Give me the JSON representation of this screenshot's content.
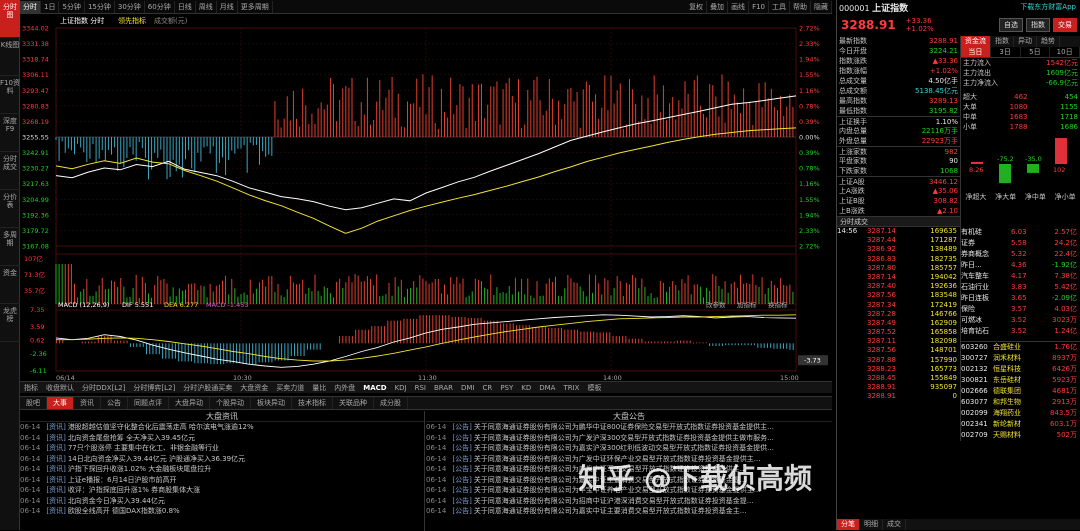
{
  "nav": [
    "分时图",
    "K线图",
    "F10资料",
    "深度F9",
    "分时成交",
    "分价表",
    "多周期",
    "资金",
    "龙虎榜"
  ],
  "toolbar": {
    "tabs": [
      "分时",
      "1日",
      "5分钟",
      "15分钟",
      "30分钟",
      "60分钟",
      "日线",
      "周线",
      "月线",
      "更多周期"
    ],
    "right": [
      "复权",
      "叠加",
      "画线",
      "F10",
      "工具",
      "帮助",
      "隐藏"
    ]
  },
  "chart_header": {
    "name": "上证指数",
    "period": "分时",
    "indicator": "领先指标",
    "volume_label": "成交额(元)"
  },
  "price_axis": {
    "left": [
      "3344.02",
      "3331.38",
      "3318.74",
      "3306.11",
      "3293.47",
      "3280.83",
      "3268.19",
      "3255.55",
      "3242.91",
      "3230.27",
      "3217.63",
      "3204.99",
      "3192.36",
      "3179.72",
      "3167.08"
    ],
    "right": [
      "2.72%",
      "2.33%",
      "1.94%",
      "1.55%",
      "1.16%",
      "0.78%",
      "0.39%",
      "0.00%",
      "0.39%",
      "0.78%",
      "1.16%",
      "1.55%",
      "1.94%",
      "2.33%",
      "2.72%"
    ]
  },
  "volume_axis": [
    "107亿",
    "71.3亿",
    "35.7亿"
  ],
  "macd": {
    "label": "MACD (12,26,9)",
    "dif": "DIF 5.551",
    "dea": "DEA 6.277",
    "macd": "MACD -1.453",
    "axis": [
      "7.35",
      "3.59",
      "0.62",
      "-2.36",
      "-6.11"
    ],
    "current": "-3.73",
    "right_tools": [
      "改参数",
      "加指标",
      "换指标"
    ]
  },
  "time_axis": [
    "06/14",
    "10:30",
    "11:30",
    "14:00",
    "15:00"
  ],
  "indicator_tabs": [
    "指标",
    "收盘默认",
    "分时DDX[L2]",
    "分时博弈[L2]",
    "分时沪股通买卖",
    "大盘资金",
    "买卖力道",
    "量比",
    "内外盘",
    "MACD",
    "KDJ",
    "RSI",
    "BRAR",
    "DMI",
    "CR",
    "PSY",
    "KD",
    "DMA",
    "TRIX",
    "模板"
  ],
  "news": {
    "tabs": [
      "股吧",
      "大事",
      "资讯",
      "公告",
      "同题点评",
      "大盘异动",
      "个股异动",
      "板块异动",
      "技术指标",
      "关联品种",
      "成分股"
    ],
    "left_title": "大盘资讯",
    "right_title": "大盘公告",
    "left": [
      {
        "d": "06-14",
        "t": "[资讯]",
        "s": "港股超越估值坚守化整合化后震荡走高 哈尔滨电气涨逾12%"
      },
      {
        "d": "06-14",
        "t": "[资讯]",
        "s": "北向资金尾盘抢筹 全天净买入39.45亿元"
      },
      {
        "d": "06-14",
        "t": "[资讯]",
        "s": "77只个股涨停 主要集中在化工、非银金融等行业"
      },
      {
        "d": "06-14",
        "t": "[资讯]",
        "s": "14日北向资金净买入39.44亿元 沪股通净买入36.39亿元"
      },
      {
        "d": "06-14",
        "t": "[资讯]",
        "s": "沪指下探回升收涨1.02% 大金融板块尾盘拉升"
      },
      {
        "d": "06-14",
        "t": "[资讯]",
        "s": "上证e播报：6月14日沪股市前高开"
      },
      {
        "d": "06-14",
        "t": "[资讯]",
        "s": "收评：沪指探底回升涨1% 券商股集体大涨"
      },
      {
        "d": "06-14",
        "t": "[资讯]",
        "s": "北向资金今日净买入39.44亿元"
      },
      {
        "d": "06-14",
        "t": "[资讯]",
        "s": "欧股全线高开 德国DAX指数涨0.8%"
      }
    ],
    "right": [
      {
        "d": "06-14",
        "t": "[公告]",
        "s": "关于同意海通证券股份有限公司为鹏华中证800证券保险交易型开放式指数证券投资基金提供主..."
      },
      {
        "d": "06-14",
        "t": "[公告]",
        "s": "关于同意海通证券股份有限公司为广发沪深300交易型开放式指数证券投资基金提供主做市服务..."
      },
      {
        "d": "06-14",
        "t": "[公告]",
        "s": "关于同意海通证券股份有限公司为嘉实沪深300红利低波动交易型开放式指数证券投资基金提供..."
      },
      {
        "d": "06-14",
        "t": "[公告]",
        "s": "关于同意海通证券股份有限公司为广发中证环保产业交易型开放式指数证券投资基金提供主..."
      },
      {
        "d": "06-14",
        "t": "[公告]",
        "s": "关于同意海通证券股份有限公司为广发中证军工交易型开放式指数证券投资基金提供主..."
      },
      {
        "d": "06-14",
        "t": "[公告]",
        "s": "关于同意海通证券股份有限公司为嘉实中证主要消费交易型开放式指数证券投资基金提..."
      },
      {
        "d": "06-14",
        "t": "[公告]",
        "s": "关于同意海通证券股份有限公司为华宝中证养老产业交易型开放式指数证券投资基金提供主..."
      },
      {
        "d": "06-14",
        "t": "[公告]",
        "s": "关于同意海通证券股份有限公司为招商中证沪港深消费交易型开放式指数证券投资基金提..."
      },
      {
        "d": "06-14",
        "t": "[公告]",
        "s": "关于同意海通证券股份有限公司为嘉实中证主要消费交易型开放式指数证券投资基金主..."
      }
    ]
  },
  "quote": {
    "code": "000001",
    "name": "上证指数",
    "price": "3288.91",
    "change": "+33.36",
    "pct": "+1.02%",
    "download": "下载东方财富App",
    "buttons": {
      "watch": "自选",
      "index": "指数",
      "trade": "交易"
    },
    "fields": [
      {
        "k": "最新指数",
        "v": "3288.91",
        "c": "red"
      },
      {
        "k": "今日开盘",
        "v": "3224.21",
        "c": "grn"
      },
      {
        "k": "指数涨跌",
        "v": "▲33.36",
        "c": "red"
      },
      {
        "k": "指数涨幅",
        "v": "+1.02%",
        "c": "red"
      },
      {
        "k": "总成交量",
        "v": "4.50亿手",
        "c": "wht"
      },
      {
        "k": "总成交额",
        "v": "5138.45亿元",
        "c": "cyan"
      },
      {
        "k": "最高指数",
        "v": "3289.13",
        "c": "red"
      },
      {
        "k": "最低指数",
        "v": "3195.82",
        "c": "grn"
      },
      {
        "k": "上证换手",
        "v": "1.10%",
        "c": "wht"
      },
      {
        "k": "内盘总量",
        "v": "22116万手",
        "c": "grn"
      },
      {
        "k": "外盘总量",
        "v": "22923万手",
        "c": "red"
      },
      {
        "k": "上涨家数",
        "v": "982",
        "c": "red"
      },
      {
        "k": "平盘家数",
        "v": "90",
        "c": "wht"
      },
      {
        "k": "下跌家数",
        "v": "1068",
        "c": "grn"
      },
      {
        "k": "上证A股",
        "v": "3446.12",
        "c": "red"
      },
      {
        "k": "上A涨跌",
        "v": "▲35.06",
        "c": "red"
      },
      {
        "k": "上证B股",
        "v": "308.82",
        "c": "red"
      },
      {
        "k": "上B涨跌",
        "v": "▲2.10",
        "c": "red"
      }
    ],
    "fund_tabs": [
      "资金流",
      "指数",
      "异动",
      "趋势"
    ],
    "fund_subtabs": [
      "当日",
      "3日",
      "5日",
      "10日"
    ],
    "fund_flow": [
      {
        "k": "主力流入",
        "v": "1542亿元",
        "c": "red"
      },
      {
        "k": "主力流出",
        "v": "1609亿元",
        "c": "grn"
      },
      {
        "k": "主力净流入",
        "v": "-66.9亿元",
        "c": "grn"
      }
    ],
    "fund_table": [
      {
        "k": "超大",
        "a": "462",
        "b": "454"
      },
      {
        "k": "大单",
        "a": "1080",
        "b": "1155"
      },
      {
        "k": "中单",
        "a": "1683",
        "b": "1718"
      },
      {
        "k": "小单",
        "a": "1788",
        "b": "1686"
      }
    ],
    "fund_bars": [
      {
        "label": "超大单",
        "value": 8.26
      },
      {
        "label": "大单",
        "value": -75.2
      },
      {
        "label": "中单",
        "value": -35.0
      },
      {
        "label": "小单",
        "value": 102
      }
    ],
    "fund_bar_labels": [
      "8.26",
      "-75.2",
      "-35.0",
      "102"
    ],
    "fund_bar_names": [
      "净超大",
      "净大单",
      "净中单",
      "净小单"
    ],
    "ticks_title": "分时成交",
    "ticks": [
      {
        "t": "14:56",
        "p": "3287.14",
        "v": "169635"
      },
      {
        "t": "",
        "p": "3287.44",
        "v": "171287"
      },
      {
        "t": "",
        "p": "3286.92",
        "v": "138489"
      },
      {
        "t": "",
        "p": "3286.83",
        "v": "182735"
      },
      {
        "t": "",
        "p": "3287.80",
        "v": "185757"
      },
      {
        "t": "",
        "p": "3287.14",
        "v": "194042"
      },
      {
        "t": "",
        "p": "3287.40",
        "v": "192636"
      },
      {
        "t": "",
        "p": "3287.56",
        "v": "183548"
      },
      {
        "t": "",
        "p": "3287.34",
        "v": "172419"
      },
      {
        "t": "",
        "p": "3287.28",
        "v": "146766"
      },
      {
        "t": "",
        "p": "3287.49",
        "v": "162909"
      },
      {
        "t": "",
        "p": "3287.52",
        "v": "165858"
      },
      {
        "t": "",
        "p": "3287.11",
        "v": "182098"
      },
      {
        "t": "",
        "p": "3287.56",
        "v": "148701"
      },
      {
        "t": "",
        "p": "3287.88",
        "v": "157990"
      },
      {
        "t": "",
        "p": "3288.23",
        "v": "165773"
      },
      {
        "t": "",
        "p": "3288.45",
        "v": "155849"
      },
      {
        "t": "",
        "p": "3288.91",
        "v": "935097"
      },
      {
        "t": "",
        "p": "3288.91",
        "v": "0"
      }
    ],
    "sectors": [
      {
        "n": "有机硅",
        "p": "6.03",
        "v": "2.57亿"
      },
      {
        "n": "证券",
        "p": "5.58",
        "v": "24.2亿"
      },
      {
        "n": "券商概念",
        "p": "5.32",
        "v": "22.4亿"
      },
      {
        "n": "昨日...",
        "p": "4.36",
        "v": "-1.92亿"
      },
      {
        "n": "汽车整车",
        "p": "4.17",
        "v": "7.38亿"
      },
      {
        "n": "石油行业",
        "p": "3.83",
        "v": "5.42亿"
      },
      {
        "n": "昨日连板",
        "p": "3.65",
        "v": "-2.09亿"
      },
      {
        "n": "保险",
        "p": "3.57",
        "v": "4.03亿"
      },
      {
        "n": "可燃冰",
        "p": "3.52",
        "v": "3023万"
      },
      {
        "n": "培育钻石",
        "p": "3.52",
        "v": "1.24亿"
      }
    ],
    "stocks": [
      {
        "c": "603260",
        "n": "合盛硅业",
        "v": "1.76亿"
      },
      {
        "c": "300727",
        "n": "润禾材料",
        "v": "8937万"
      },
      {
        "c": "002132",
        "n": "恒星科技",
        "v": "6426万"
      },
      {
        "c": "300821",
        "n": "东岳硅材",
        "v": "5923万"
      },
      {
        "c": "002666",
        "n": "德联集团",
        "v": "4681万"
      },
      {
        "c": "603077",
        "n": "和邦生物",
        "v": "2913万"
      },
      {
        "c": "002099",
        "n": "海翔药业",
        "v": "843.5万"
      },
      {
        "c": "002341",
        "n": "新纶新材",
        "v": "603.1万"
      },
      {
        "c": "002709",
        "n": "天赐材料",
        "v": "502万"
      }
    ],
    "bottom_tabs": [
      "分笔",
      "明细",
      "成交"
    ]
  },
  "watermark": "知乎 @下载侦高频",
  "chart_data": {
    "type": "line",
    "title": "上证指数 分时",
    "ylim": [
      3167.08,
      3344.02
    ],
    "prev_close": 3255.55,
    "price": [
      3224.2,
      3222.5,
      3227.1,
      3230.4,
      3228.9,
      3233.2,
      3231.5,
      3235.8,
      3229.3,
      3226.7,
      3224.1,
      3219.6,
      3214.3,
      3210.8,
      3207.2,
      3205.5,
      3203.1,
      3199.4,
      3196.5,
      3198.2,
      3201.7,
      3205.3,
      3203.8,
      3210.1,
      3214.6,
      3219.2,
      3222.8,
      3227.9,
      3232.5,
      3237.3,
      3242.1,
      3247.4,
      3252.8,
      3256.3,
      3259.7,
      3262.9,
      3266.1,
      3268.5,
      3271.2,
      3273.8,
      3276.4,
      3279.3,
      3282.1,
      3283.5,
      3285.2,
      3287.1,
      3288.9
    ],
    "lead": [
      3232.1,
      3229.8,
      3233.4,
      3236.2,
      3234.1,
      3238.5,
      3235.2,
      3233.9,
      3228.4,
      3224.1,
      3219.7,
      3214.2,
      3208.6,
      3203.9,
      3199.8,
      3194.5,
      3189.6,
      3183.2,
      3177.4,
      3181.5,
      3187.3,
      3191.6,
      3195.9,
      3199.4,
      3202.7,
      3205.9,
      3208.8,
      3212.2,
      3215.6,
      3219.4,
      3223.1,
      3227.5,
      3231.3,
      3235.7,
      3239.1,
      3242.6,
      3245.4,
      3248.2,
      3251.1,
      3253.6,
      3255.9,
      3257.8,
      3259.2,
      3260.6,
      3261.5,
      3262.2,
      3262.9
    ],
    "macd_dif": [
      1.2,
      0.8,
      1.1,
      1.9,
      1.5,
      0.7,
      -0.4,
      -1.3,
      -2.1,
      -2.8,
      -3.5,
      -4.0,
      -4.6,
      -5.0,
      -5.3,
      -5.1,
      -4.6,
      -3.9,
      -2.9,
      -1.8,
      -0.9,
      0.3,
      1.2,
      2.3,
      3.1,
      3.6,
      4.2,
      4.5,
      4.8,
      5.1,
      5.4,
      5.7,
      5.9,
      6.1,
      6.3,
      6.2,
      6.0,
      5.8,
      5.9,
      6.1,
      5.9,
      5.6,
      5.8,
      5.9,
      5.7,
      5.6,
      5.55
    ],
    "macd_dea": [
      0.8,
      0.8,
      0.9,
      1.1,
      1.2,
      1.1,
      0.8,
      0.4,
      -0.1,
      -0.6,
      -1.2,
      -1.8,
      -2.3,
      -2.9,
      -3.4,
      -3.7,
      -3.9,
      -3.9,
      -3.7,
      -3.3,
      -2.8,
      -2.2,
      -1.5,
      -0.8,
      0.0,
      0.7,
      1.4,
      2.0,
      2.6,
      3.1,
      3.6,
      4.0,
      4.4,
      4.8,
      5.1,
      5.4,
      5.5,
      5.6,
      5.7,
      5.8,
      5.8,
      5.9,
      6.0,
      6.1,
      6.2,
      6.2,
      6.28
    ]
  }
}
